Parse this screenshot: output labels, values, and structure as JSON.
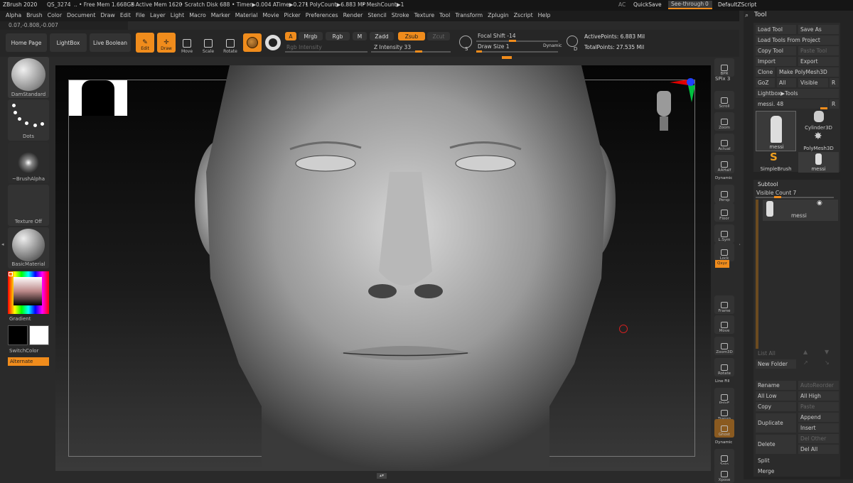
{
  "titlebar": {
    "app": "ZBrush 2020",
    "doc": "QS_3274",
    "sep": "..",
    "free_mem": "• Free Mem 1.668GB",
    "active_mem": "• Active Mem 1620",
    "scratch": "• Scratch Disk 688",
    "timer": "• Timer▶0.004 ATime▶0.271",
    "polycount": "• PolyCount▶6.883 MP",
    "meshcount": "• MeshCount▶1",
    "ac": "AC",
    "quicksave": "QuickSave",
    "seethrough": "See-through",
    "seethrough_val": "0",
    "zscript": "DefaultZScript"
  },
  "menu": [
    "Alpha",
    "Brush",
    "Color",
    "Document",
    "Draw",
    "Edit",
    "File",
    "Layer",
    "Light",
    "Macro",
    "Marker",
    "Material",
    "Movie",
    "Picker",
    "Preferences",
    "Render",
    "Stencil",
    "Stroke",
    "Texture",
    "Tool",
    "Transform",
    "Zplugin",
    "Zscript",
    "Help"
  ],
  "coords": "0.07,-0.808,-0.007",
  "shelf": {
    "home": "Home Page",
    "lightbox": "LightBox",
    "liveboolean": "Live Boolean",
    "edit": "Edit",
    "draw": "Draw",
    "move": "Move",
    "scale": "Scale",
    "rotate": "Rotate",
    "a": "A",
    "mrgb": "Mrgb",
    "rgb": "Rgb",
    "m": "M",
    "zadd": "Zadd",
    "zsub": "Zsub",
    "zcut": "Zcut",
    "rgb_intensity": "Rgb Intensity",
    "z_intensity": "Z Intensity 33",
    "focal": "Focal Shift -14",
    "drawsize": "Draw Size 1",
    "dynamic": "Dynamic",
    "active_points": "ActivePoints: 6.883 Mil",
    "total_points": "TotalPoints: 27.535 Mil",
    "s": "S",
    "d": "D"
  },
  "left": {
    "brush": "DamStandard",
    "stroke": "Dots",
    "alpha": "~BrushAlpha",
    "texture": "Texture Off",
    "material": "BasicMaterial",
    "gradient": "Gradient",
    "switchcolor": "SwitchColor",
    "alternate": "Alternate"
  },
  "rightbar": [
    "BPR",
    "SPix 3",
    "Scroll",
    "Zoom",
    "Actual",
    "AAHalf",
    "Dynamic",
    "Persp",
    "Floor",
    "L.Sym",
    "Lock",
    "Qxyz",
    "Frame",
    "Move",
    "Zoom3D",
    "Rotate",
    "Line Fill",
    "PolyF",
    "Transp",
    "Ghost",
    "Dynamic",
    "Solo",
    "Xpose"
  ],
  "tool": {
    "title": "Tool",
    "load_tool": "Load Tool",
    "save_as": "Save As",
    "load_from_project": "Load Tools From Project",
    "copy_tool": "Copy Tool",
    "paste_tool": "Paste Tool",
    "import": "Import",
    "export": "Export",
    "clone": "Clone",
    "make_polymesh": "Make PolyMesh3D",
    "goz": "GoZ",
    "all": "All",
    "visible": "Visible",
    "r": "R",
    "lightbox_tools": "Lightbox▶Tools",
    "current": "messi. 48",
    "r2": "R",
    "thumbs": [
      "messi",
      "Cylinder3D",
      "PolyMesh3D",
      "SimpleBrush",
      "messi"
    ]
  },
  "subtool": {
    "title": "Subtool",
    "visible_count": "Visible Count 7",
    "item": "messi",
    "list_all": "List All",
    "new_folder": "New Folder",
    "rename": "Rename",
    "autoreorder": "AutoReorder",
    "all_low": "All Low",
    "all_high": "All High",
    "copy": "Copy",
    "paste": "Paste",
    "append": "Append",
    "duplicate": "Duplicate",
    "insert": "Insert",
    "delete": "Delete",
    "del_other": "Del Other",
    "del_all": "Del All",
    "split": "Split",
    "merge": "Merge"
  },
  "colors": {
    "accent": "#f08c1c",
    "panel": "#2a2a2a",
    "viewport_top": "#050505",
    "viewport_bottom": "#3a3a3a"
  }
}
